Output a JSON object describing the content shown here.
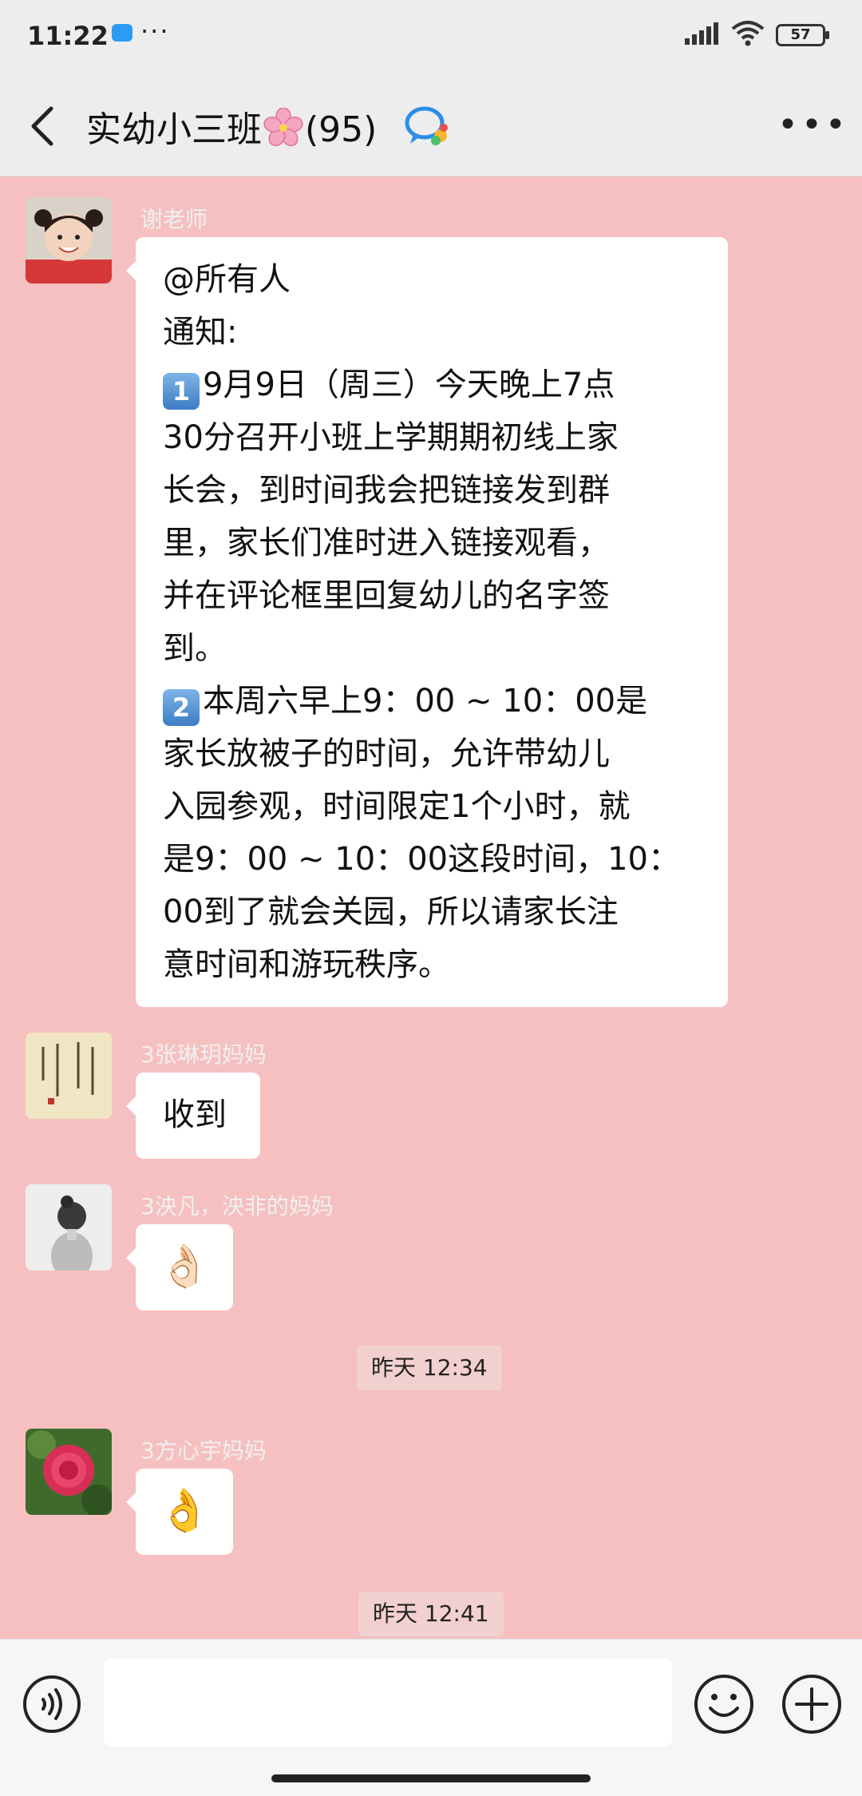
{
  "status_bar": {
    "time": "11:22",
    "extra": "···",
    "battery": "57"
  },
  "header": {
    "title_part1": "实幼小三班",
    "title_part2": "(95)"
  },
  "messages": [
    {
      "sender": "谢老师",
      "lines": [
        {
          "text": "@所有人"
        },
        {
          "text": "通知:"
        },
        {
          "num": "1",
          "text": "9月9日（周三）今天晚上7点"
        },
        {
          "text": "30分召开小班上学期期初线上家"
        },
        {
          "text": "长会，到时间我会把链接发到群"
        },
        {
          "text": "里，家长们准时进入链接观看，"
        },
        {
          "text": "并在评论框里回复幼儿的名字签"
        },
        {
          "text": "到。"
        },
        {
          "num": "2",
          "text": "本周六早上9：00 ~ 10：00是"
        },
        {
          "text": "家长放被子的时间，允许带幼儿"
        },
        {
          "text": "入园参观，时间限定1个小时，就"
        },
        {
          "text": "是9：00 ~ 10：00这段时间，10："
        },
        {
          "text": "00到了就会关园，所以请家长注"
        },
        {
          "text": "意时间和游玩秩序。"
        }
      ]
    },
    {
      "sender": "3张琳玥妈妈",
      "text": "收到"
    },
    {
      "sender": "3泱凡，泱非的妈妈",
      "emoji": "👌🏻"
    },
    {
      "timestamp": "昨天 12:34"
    },
    {
      "sender": "3方心宇妈妈",
      "emoji": "👌"
    },
    {
      "timestamp": "昨天 12:41"
    }
  ],
  "colors": {
    "chat_bg": "#f6c0c0",
    "bubble": "#ffffff",
    "header_bg": "#ededed"
  }
}
